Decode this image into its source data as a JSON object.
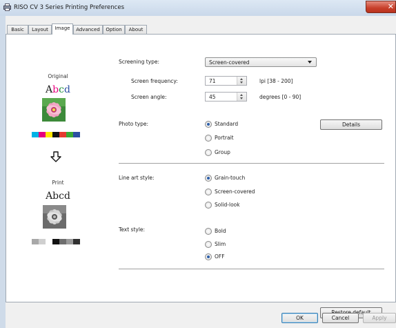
{
  "window": {
    "title": "RISO CV 3 Series Printing Preferences",
    "close_glyph": "✕"
  },
  "tabs": [
    "Basic",
    "Layout",
    "Image",
    "Advanced",
    "Option",
    "About"
  ],
  "active_tab": "Image",
  "preview": {
    "original_label": "Original",
    "print_label": "Print",
    "sample_text": "Abcd",
    "original_swatch_colors": [
      "#00b3e6",
      "#e6007e",
      "#ffe600",
      "#111111",
      "#e53a2f",
      "#39a935",
      "#2b4fa2"
    ],
    "print_swatch_colors": [
      "#a8a8a8",
      "#cfcfcf",
      "#ffffff",
      "#111111",
      "#6e6e6e",
      "#9a9a9a",
      "#303030"
    ]
  },
  "screening": {
    "label": "Screening type:",
    "value": "Screen-covered",
    "frequency": {
      "label": "Screen frequency:",
      "value": "71",
      "range": "lpi [38 - 200]"
    },
    "angle": {
      "label": "Screen angle:",
      "value": "45",
      "range": "degrees [0 - 90]"
    }
  },
  "photo_type": {
    "label": "Photo type:",
    "options": [
      "Standard",
      "Portrait",
      "Group"
    ],
    "selected": "Standard",
    "details_button": "Details"
  },
  "line_art_style": {
    "label": "Line art style:",
    "options": [
      "Grain-touch",
      "Screen-covered",
      "Solid-look"
    ],
    "selected": "Grain-touch"
  },
  "text_style": {
    "label": "Text style:",
    "options": [
      "Bold",
      "Slim",
      "OFF"
    ],
    "selected": "OFF"
  },
  "buttons": {
    "restore_default": "Restore default",
    "ok": "OK",
    "cancel": "Cancel",
    "apply": "Apply"
  }
}
